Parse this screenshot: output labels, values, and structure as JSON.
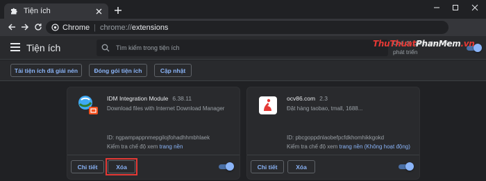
{
  "browser": {
    "tab_title": "Tiện ích",
    "new_tab_symbol": "+",
    "window_controls": [
      "minimize",
      "maximize",
      "close"
    ],
    "omnibox": {
      "site_label": "Chrome",
      "separator": "|",
      "url_scheme": "chrome://",
      "url_path": "extensions"
    }
  },
  "header": {
    "title": "Tiện ích",
    "search_placeholder": "Tìm kiếm trong tiện ích",
    "dev_mode_label": "Chế độ dành cho nhà phát triển",
    "dev_mode_on": true
  },
  "actions": {
    "load_unpacked": "Tải tiện ích đã giải nén",
    "pack": "Đóng gói tiện ích",
    "update": "Cập nhật"
  },
  "extensions": [
    {
      "name": "IDM Integration Module",
      "version": "6.38.11",
      "description": "Download files with Internet Download Manager",
      "id": "ID: ngpampappnmepgilojfohadhhmbhlaek",
      "inspect_label": "Kiểm tra chế độ xem",
      "inspect_link": "trang nền",
      "details_label": "Chi tiết",
      "remove_label": "Xóa",
      "enabled": true,
      "icon": "idm-icon"
    },
    {
      "name": "ocv86.com",
      "version": "2.3",
      "description": "Đặt hàng taobao, tmall, 1688...",
      "id": "ID: pbcgoppdnlaobefpcfdkhomhikkgokd",
      "inspect_label": "Kiểm tra chế độ xem",
      "inspect_link": "trang nền (Không hoạt động)",
      "details_label": "Chi tiết",
      "remove_label": "Xóa",
      "enabled": true,
      "icon": "ocv86-icon"
    }
  ],
  "watermark": {
    "part_a": "ThuThuat",
    "part_b": "PhanMem",
    "part_c": ".vn"
  },
  "colors": {
    "accent": "#8ab4f8",
    "highlight": "#e53935",
    "background": "#202124",
    "surface": "#292a2d"
  }
}
